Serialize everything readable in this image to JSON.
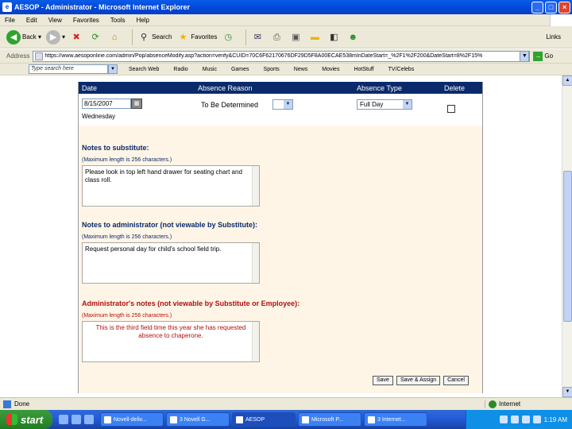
{
  "window": {
    "title": "AESOP - Administrator - Microsoft Internet Explorer",
    "minimize": "_",
    "maximize": "□",
    "close": "×"
  },
  "menu": [
    "File",
    "Edit",
    "View",
    "Favorites",
    "Tools",
    "Help"
  ],
  "toolbar": {
    "back": "Back",
    "search": "Search",
    "favorites": "Favorites",
    "links": "Links"
  },
  "address": {
    "label": "Address",
    "url": "https://www.aesoponline.com/admin/Pop/absenceModify.asp?action=verify&CUID=70C6F62170676DF29D5F8A00ECAE538mInDateStart=_%2F1%2F200&DateStart=8%2F15%",
    "go": "Go"
  },
  "linkbar": {
    "search_placeholder": "Type search here",
    "items": [
      "Search Web",
      "Radio",
      "Music",
      "Games",
      "Sports",
      "News",
      "Movies",
      "HotStuff",
      "TV/Celebs"
    ]
  },
  "form": {
    "headers": {
      "date": "Date",
      "reason": "Absence Reason",
      "type": "Absence Type",
      "delete": "Delete"
    },
    "date_value": "8/15/2007",
    "weekday": "Wednesday",
    "reason_value": "To Be Determined",
    "type_value": "Full Day",
    "notes_sub": {
      "label": "Notes to substitute:",
      "max": "(Maximum length is 256 characters.)",
      "text": "Please look in top left hand drawer for seating chart and class roll."
    },
    "notes_admin": {
      "label": "Notes to administrator (not viewable by Substitute):",
      "max": "(Maximum length is 256 characters.)",
      "text": "Request personal day for child's school field trip."
    },
    "admin_notes": {
      "label": "Administrator's notes (not viewable by Substitute or Employee):",
      "max": "(Maximum length is 256 characters.)",
      "text": "This is the third field time this year she has requested absence to chaperone."
    },
    "buttons": {
      "save": "Save",
      "save_assign": "Save & Assign",
      "cancel": "Cancel"
    }
  },
  "status": {
    "text": "Done",
    "zone": "Internet"
  },
  "taskbar": {
    "start": "start",
    "tasks": [
      "Novell-deliv...",
      "3 Novell G...",
      "AESOP",
      "Microsoft P...",
      "3 Internet..."
    ],
    "clock": "1:19 AM"
  }
}
